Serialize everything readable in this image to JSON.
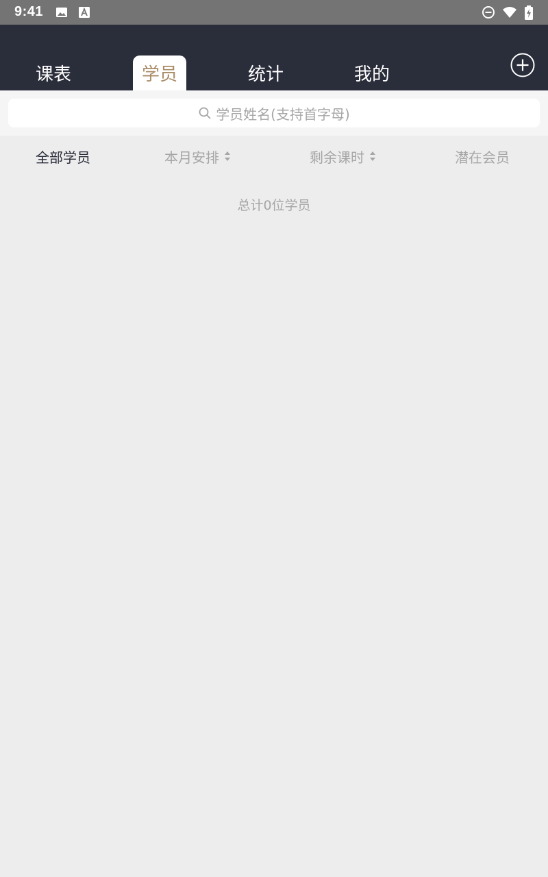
{
  "status_bar": {
    "time": "9:41",
    "icons": [
      "image-icon",
      "text-a-icon",
      "do-not-disturb-icon",
      "wifi-icon",
      "battery-charging-icon"
    ]
  },
  "tabs": [
    {
      "label": "课表",
      "active": false
    },
    {
      "label": "学员",
      "active": true
    },
    {
      "label": "统计",
      "active": false
    },
    {
      "label": "我的",
      "active": false
    }
  ],
  "header": {
    "add_icon": "plus-circle-icon"
  },
  "search": {
    "placeholder": "学员姓名(支持首字母)"
  },
  "filters": {
    "all_students": "全部学员",
    "month_schedule": "本月安排",
    "remaining_hours": "剩余课时",
    "potential_members": "潜在会员",
    "active": "all_students"
  },
  "summary": {
    "total_text": "总计0位学员"
  },
  "colors": {
    "header_bg": "#2a2d3a",
    "accent": "#a98c67",
    "background": "#ededed",
    "muted_text": "#a6a6a6"
  }
}
